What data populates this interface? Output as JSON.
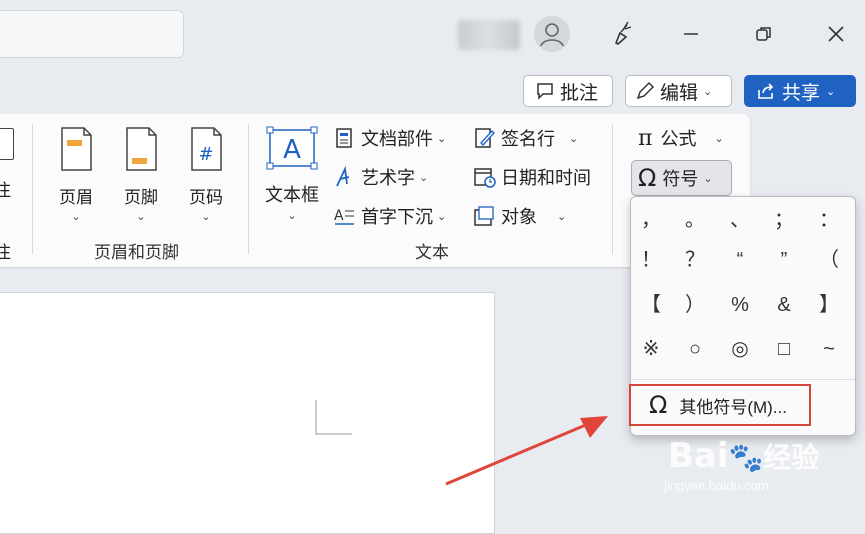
{
  "title_bar": {
    "minimize_icon": "minimize-icon",
    "restore_icon": "restore-icon",
    "close_icon": "close-icon"
  },
  "actions": {
    "comments_label": "批注",
    "edit_label": "编辑",
    "share_label": "共享"
  },
  "ribbon": {
    "partial_left": [
      "注",
      "注"
    ],
    "header_footer": {
      "items": [
        "页眉",
        "页脚",
        "页码"
      ],
      "group_label": "页眉和页脚"
    },
    "text": {
      "textbox_label": "文本框",
      "col1": [
        "文档部件",
        "艺术字",
        "首字下沉"
      ],
      "col2": [
        "签名行",
        "日期和时间",
        "对象"
      ],
      "group_label": "文本"
    },
    "symbols": {
      "formula_label": "公式",
      "symbol_label": "符号"
    }
  },
  "symbol_panel": {
    "rows": [
      [
        "，",
        "。",
        "、",
        "；",
        "："
      ],
      [
        "！",
        "？",
        "“",
        "”",
        "（"
      ],
      [
        "【",
        "）",
        "%",
        "&",
        "】"
      ],
      [
        "※",
        "○",
        "◎",
        "□",
        "~"
      ]
    ],
    "more_label": "其他符号(M)..."
  },
  "watermark": {
    "brand": "Bai",
    "brand2": "经验",
    "url": "jingyan.baidu.com"
  },
  "colors": {
    "accent": "#1f62c2",
    "highlight_red": "#d6453a"
  }
}
